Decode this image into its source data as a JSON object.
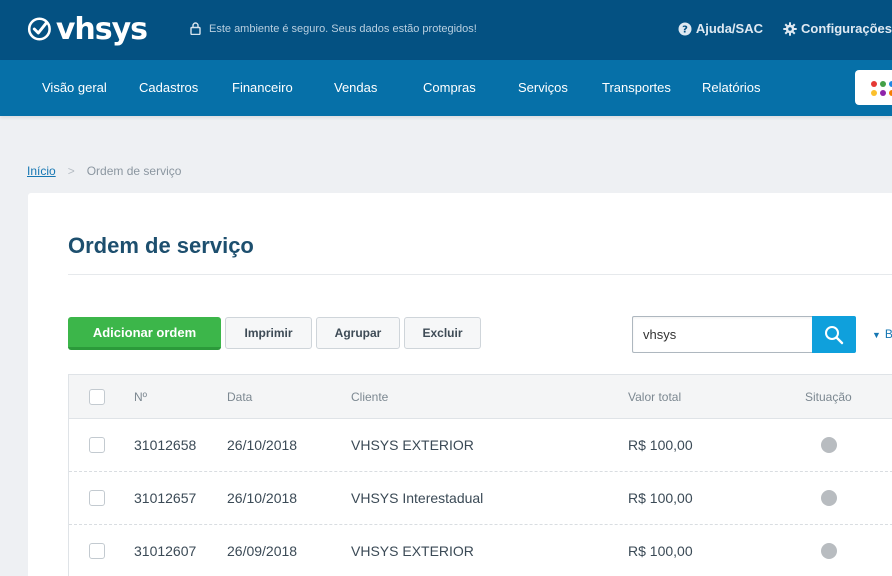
{
  "header": {
    "logo_text": "vhsys",
    "secure_text": "Este ambiente é seguro. Seus dados estão protegidos!",
    "help_label": "Ajuda/SAC",
    "settings_label": "Configurações"
  },
  "nav": {
    "items": [
      "Visão geral",
      "Cadastros",
      "Financeiro",
      "Vendas",
      "Compras",
      "Serviços",
      "Transportes",
      "Relatórios"
    ],
    "apps_colors": [
      "#e53935",
      "#43a047",
      "#1e88e5",
      "#fbc02d",
      "#8e24aa",
      "#f57c00"
    ]
  },
  "breadcrumb": {
    "home": "Início",
    "separator": ">",
    "current": "Ordem de serviço"
  },
  "page": {
    "title": "Ordem de serviço"
  },
  "toolbar": {
    "add_label": "Adicionar ordem",
    "print_label": "Imprimir",
    "group_label": "Agrupar",
    "delete_label": "Excluir",
    "search_value": "vhsys",
    "more_label": "B"
  },
  "table": {
    "headers": {
      "number": "Nº",
      "date": "Data",
      "client": "Cliente",
      "total": "Valor total",
      "status": "Situação"
    },
    "rows": [
      {
        "number": "31012658",
        "date": "26/10/2018",
        "client": "VHSYS EXTERIOR",
        "total": "R$ 100,00"
      },
      {
        "number": "31012657",
        "date": "26/10/2018",
        "client": "VHSYS Interestadual",
        "total": "R$ 100,00"
      },
      {
        "number": "31012607",
        "date": "26/09/2018",
        "client": "VHSYS EXTERIOR",
        "total": "R$ 100,00"
      }
    ]
  }
}
